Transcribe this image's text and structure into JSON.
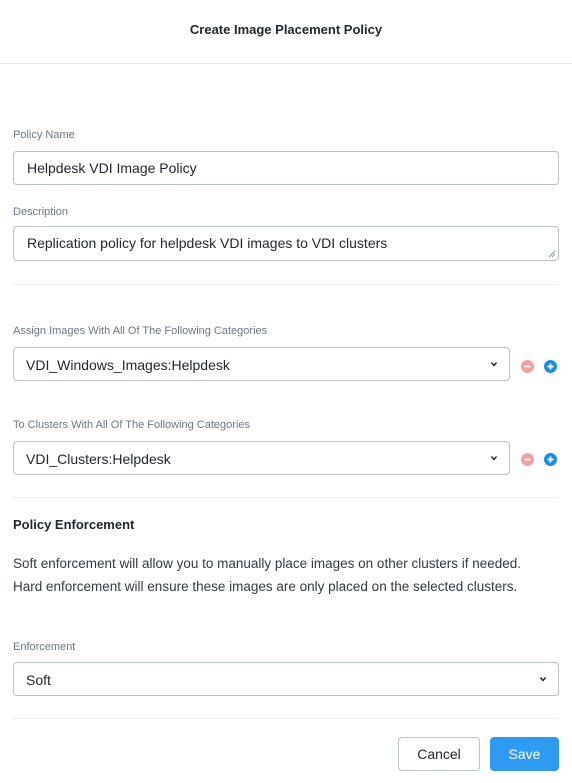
{
  "dialog": {
    "title": "Create Image Placement Policy"
  },
  "policy_name": {
    "label": "Policy Name",
    "value": "Helpdesk VDI Image Policy"
  },
  "description": {
    "label": "Description",
    "value": "Replication policy for helpdesk VDI images to VDI clusters"
  },
  "image_categories": {
    "label": "Assign Images With All Of The Following Categories",
    "selected": "VDI_Windows_Images:Helpdesk"
  },
  "cluster_categories": {
    "label": "To Clusters With All Of The Following Categories",
    "selected": "VDI_Clusters:Helpdesk"
  },
  "enforcement_section": {
    "title": "Policy Enforcement",
    "description": "Soft enforcement will allow you to manually place images on other clusters if needed. Hard enforcement will ensure these images are only placed on the selected clusters."
  },
  "enforcement": {
    "label": "Enforcement",
    "selected": "Soft"
  },
  "footer": {
    "cancel_label": "Cancel",
    "save_label": "Save"
  },
  "icons": {
    "remove": "minus-circle-icon",
    "add": "plus-circle-icon",
    "caret": "chevron-down-icon"
  },
  "colors": {
    "primary": "#2e9bf0",
    "add": "#1a8ee8",
    "remove": "#f0a0a0"
  }
}
